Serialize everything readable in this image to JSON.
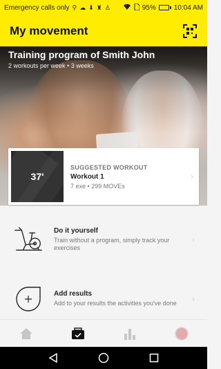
{
  "statusbar": {
    "carrier_text": "Emergency calls only",
    "battery_percent": "95%",
    "battery_level": 0.95,
    "time": "10:04 AM"
  },
  "appbar": {
    "title": "My movement",
    "scan_icon": "qr-scan-icon"
  },
  "hero": {
    "title": "Training program of Smith John",
    "subtitle": "2 workouts per week • 3 weeks"
  },
  "suggested": {
    "duration": "37'",
    "label": "SUGGESTED WORKOUT",
    "name": "Workout 1",
    "meta": "7 exe • 299 MOVEs"
  },
  "actions": [
    {
      "icon": "exercise-bike-icon",
      "title": "Do it yourself",
      "subtitle": "Train without a program, simply track your exercises"
    },
    {
      "icon": "add-results-icon",
      "title": "Add results",
      "subtitle": "Add to your results the activities you've done"
    }
  ],
  "bottom_nav": [
    {
      "icon": "home-icon",
      "selected": false
    },
    {
      "icon": "workout-bag-icon",
      "selected": true
    },
    {
      "icon": "stats-bars-icon",
      "selected": false
    },
    {
      "icon": "profile-avatar-icon",
      "selected": false
    }
  ],
  "colors": {
    "accent": "#ffec00",
    "background": "#f4f4f4",
    "card": "#ffffff"
  }
}
